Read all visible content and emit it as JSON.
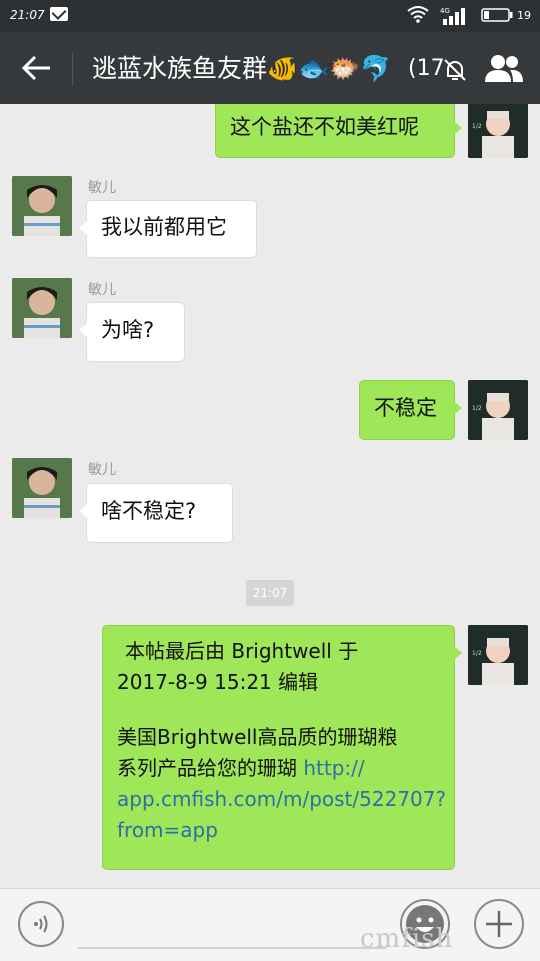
{
  "status_bar": {
    "time": "21:07",
    "network": "4G",
    "battery": "19"
  },
  "header": {
    "title": "逃蓝水族鱼友群🐠🐟🐡🐬",
    "member_count": "(17",
    "icons": [
      "back-arrow-icon",
      "mute-bell-icon",
      "group-members-icon"
    ]
  },
  "messages": [
    {
      "side": "right",
      "text": "这个盐还不如美红呢"
    },
    {
      "side": "left",
      "sender": "敏儿",
      "text": "我以前都用它"
    },
    {
      "side": "left",
      "sender": "敏儿",
      "text": "为啥?"
    },
    {
      "side": "right",
      "text": "不稳定"
    },
    {
      "side": "left",
      "sender": "敏儿",
      "text": "啥不稳定?"
    },
    {
      "type": "timestamp",
      "text": "21:07"
    },
    {
      "side": "right",
      "line1": "本帖最后由 Brightwell 于",
      "line2": "2017-8-9 15:21 编辑",
      "line3": "美国Brightwell高品质的珊瑚粮",
      "line4": "系列产品给您的珊瑚",
      "link_part1": "http://",
      "link_part2": "app.cmfish.com/m/post/522707?",
      "link_part3": "from=app"
    }
  ],
  "input_bar": {
    "icons": [
      "voice-icon",
      "emoji-icon",
      "plus-icon"
    ]
  },
  "watermark": "cmfish",
  "colors": {
    "header_bg": "#35393c",
    "status_bg": "#2e3134",
    "chat_bg": "#ebebeb",
    "green_bubble": "#9fe658",
    "link": "#2f6ea6"
  }
}
